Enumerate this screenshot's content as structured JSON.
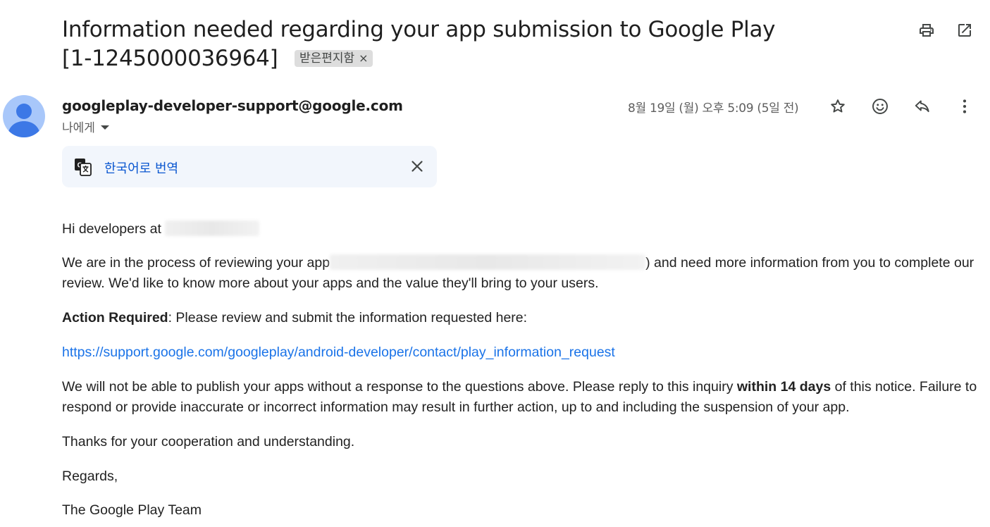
{
  "email": {
    "subject": "Information needed regarding your app submission to Google Play [1-1245000036964]",
    "label": "받은편지함",
    "label_close": "×",
    "sender": "googleplay-developer-support@google.com",
    "recipient": "나에게",
    "datetime": "8월 19일 (월) 오후 5:09 (5일 전)"
  },
  "icons": {
    "print": "print-icon",
    "open_new_window": "open-in-new-window-icon",
    "star": "star-icon",
    "emoji": "emoji-reaction-icon",
    "reply": "reply-icon",
    "more": "more-vert-icon",
    "translate": "translate-icon",
    "close": "close-icon",
    "avatar": "avatar-person-icon"
  },
  "translate": {
    "link": "한국어로 번역"
  },
  "body": {
    "greeting": "Hi developers at",
    "p1_before": "We are in the process of reviewing your app",
    "p1_after": ") and need more information from you to complete our review. We'd like to know more about your apps and the value they'll bring to your users.",
    "action_bold": "Action Required",
    "action_rest": ": Please review and submit the information requested here:",
    "url": "https://support.google.com/googleplay/android-developer/contact/play_information_request",
    "p3_before": "We will not be able to publish your apps without a response to the questions above. Please reply to this inquiry",
    "p3_bold": "within 14 days",
    "p3_after": "of this notice. Failure to respond or provide inaccurate or incorrect information may result in further action, up to and including the suspension of your app.",
    "thanks": "Thanks for your cooperation and understanding.",
    "regards": "Regards,",
    "signature": "The Google Play Team"
  },
  "colors": {
    "link": "#1a73e8",
    "translate_bg": "#f2f6fc",
    "avatar_bg": "#a8c7fa",
    "avatar_fg": "#3c78e6"
  }
}
